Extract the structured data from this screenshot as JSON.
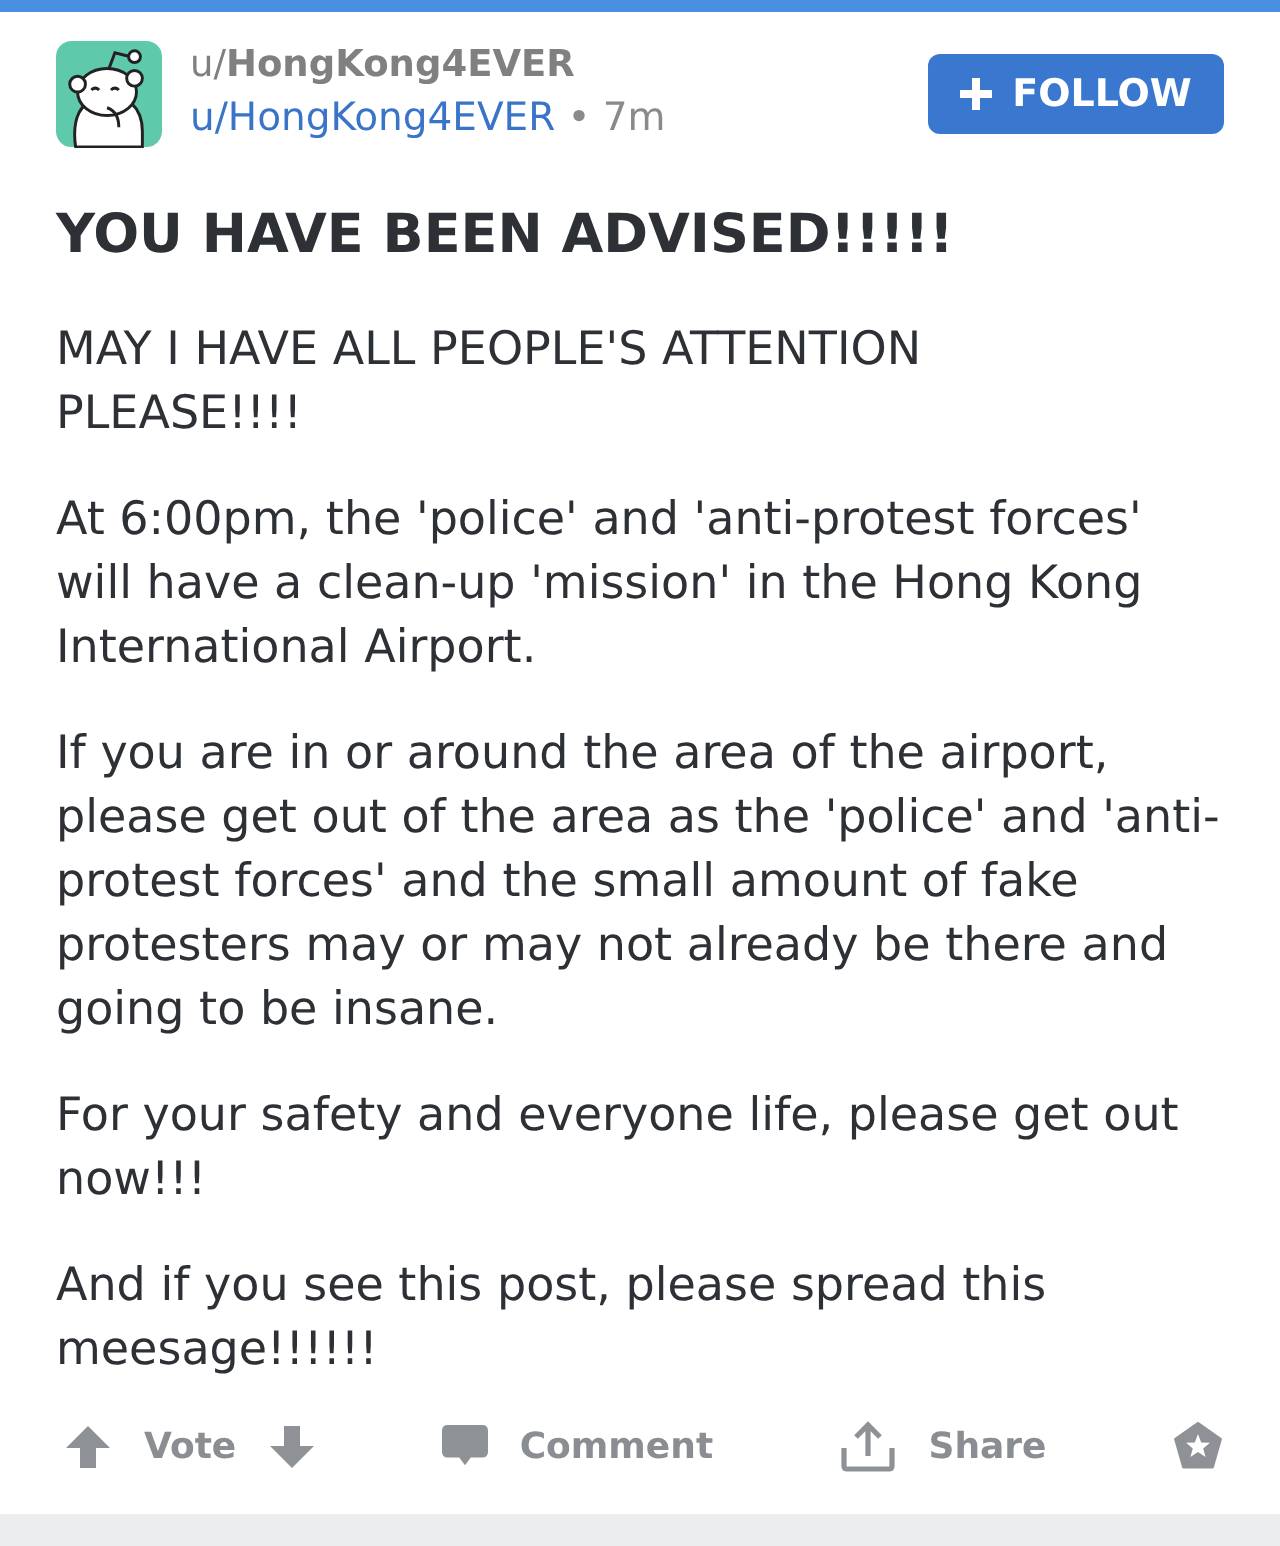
{
  "header": {
    "subtitle": "u/**HongKong4EVER**",
    "author": "u/HongKong4EVER",
    "separator": "•",
    "age": "7m",
    "follow_button": {
      "label": "FOLLOW"
    }
  },
  "post": {
    "title": "YOU HAVE BEEN ADVISED!!!!!",
    "paragraphs": [
      "MAY I HAVE ALL PEOPLE'S ATTENTION PLEASE!!!!",
      "At 6:00pm, the 'police' and 'anti-protest forces' will have a clean-up 'mission' in the Hong Kong International Airport.",
      "If you are in or around the area of the airport, please get out of the area as the 'police' and 'anti-protest forces' and the small amount of fake protesters may or may not already be there and going to be insane.",
      "For your safety and everyone life, please get out now!!!",
      "And if you see this post, please spread this meesage!!!!!!"
    ]
  },
  "actions": [
    {
      "kind": "vote",
      "label": "Vote"
    },
    {
      "kind": "comment",
      "label": "Comment"
    },
    {
      "kind": "share",
      "label": "Share"
    },
    {
      "kind": "award"
    }
  ]
}
